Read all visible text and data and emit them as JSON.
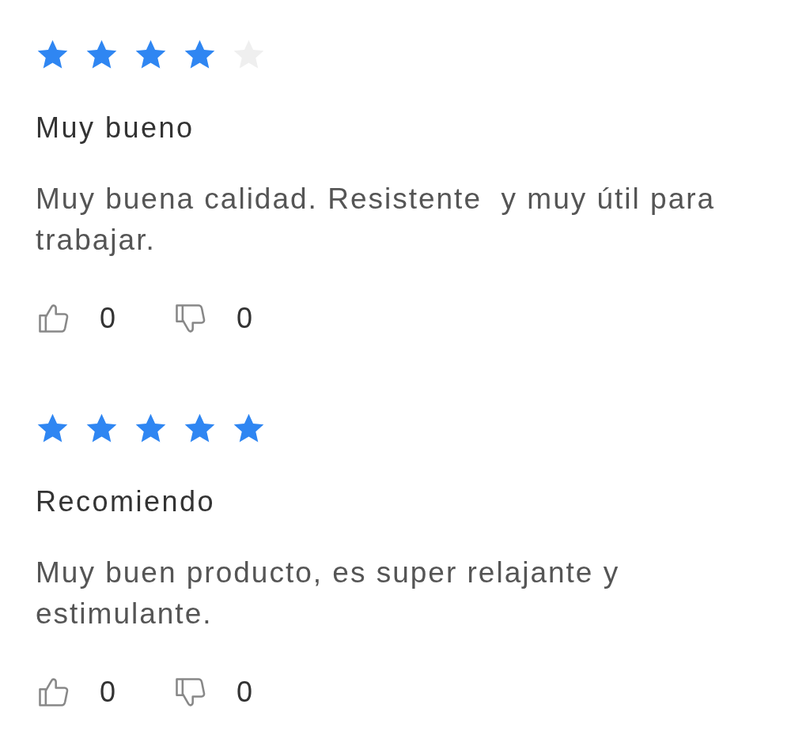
{
  "reviews": [
    {
      "stars": 4,
      "title": "Muy bueno",
      "body": "Muy buena calidad. Resistente  y muy útil para trabajar.",
      "likes": "0",
      "dislikes": "0"
    },
    {
      "stars": 5,
      "title": "Recomiendo",
      "body": "Muy buen producto, es super relajante y estimulante.",
      "likes": "0",
      "dislikes": "0"
    }
  ]
}
